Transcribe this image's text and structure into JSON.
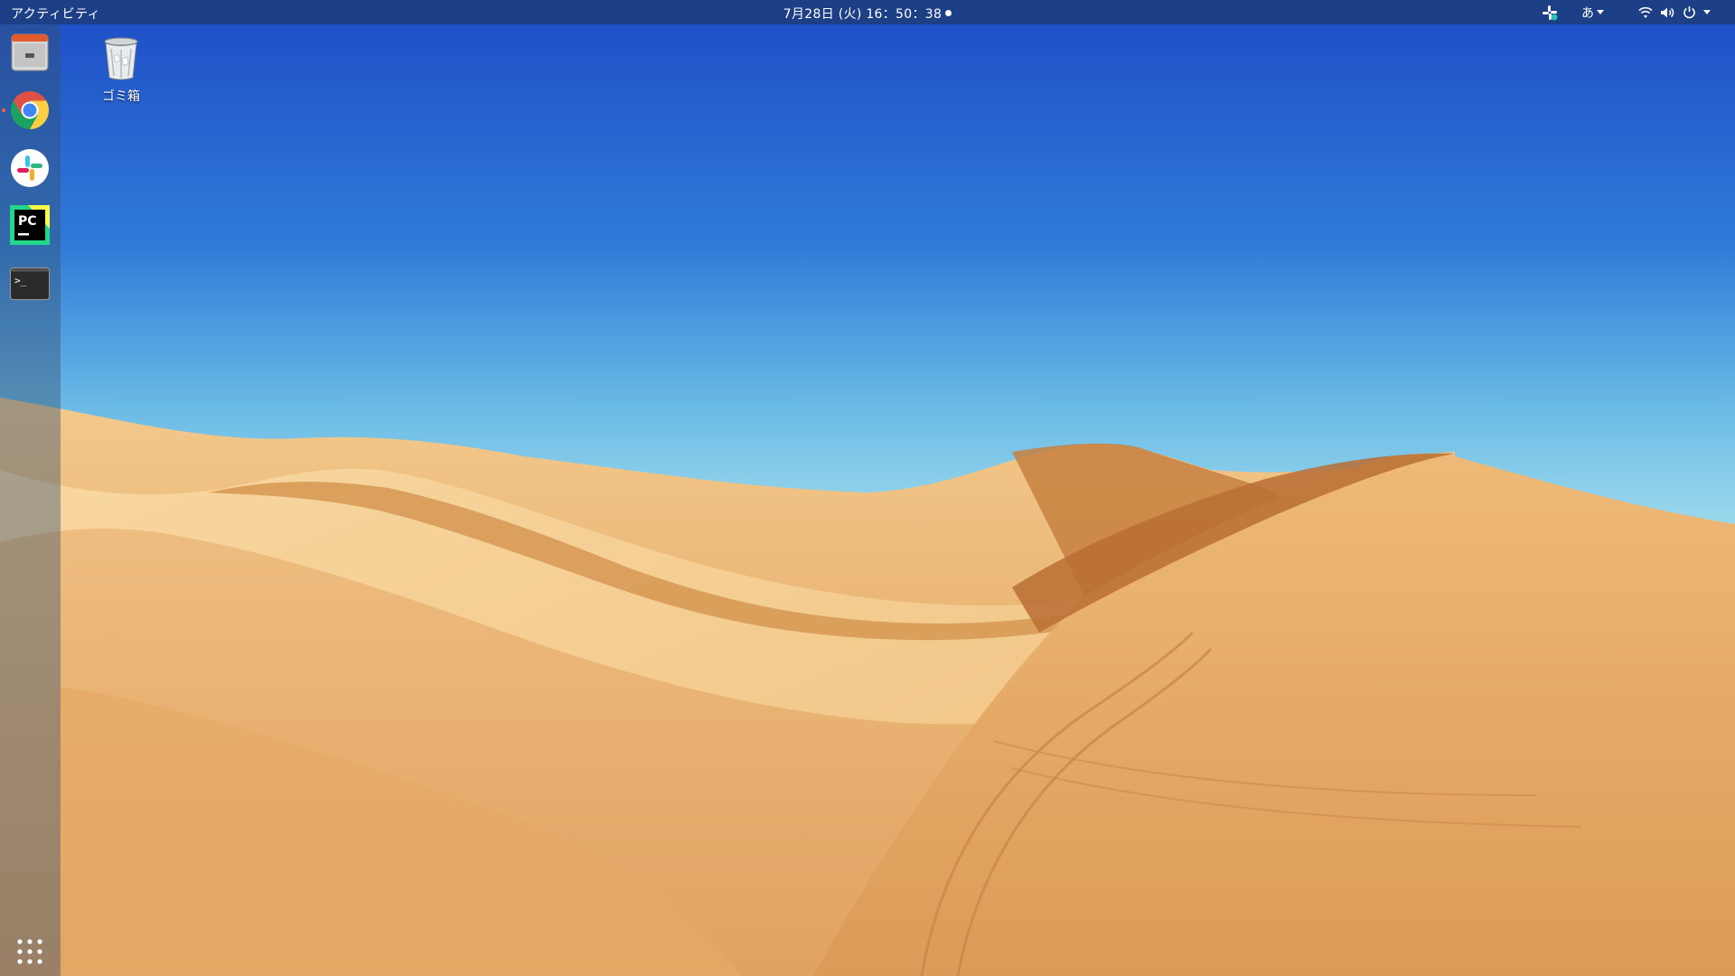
{
  "topbar": {
    "activities_label": "アクティビティ",
    "clock": "7月28日 (火) 16：50：38",
    "tray": {
      "slack_indicator_icon": "slack-icon",
      "input_method_label": "あ",
      "wifi_icon": "wifi-icon",
      "volume_icon": "volume-icon",
      "power_icon": "power-icon"
    }
  },
  "dock": {
    "items": [
      {
        "name": "files",
        "icon": "file-cabinet-icon",
        "running": false
      },
      {
        "name": "chrome",
        "icon": "chrome-icon",
        "running": true
      },
      {
        "name": "slack",
        "icon": "slack-icon",
        "running": false
      },
      {
        "name": "pycharm",
        "icon": "pycharm-icon",
        "running": false,
        "label": "PC"
      },
      {
        "name": "terminal",
        "icon": "terminal-icon",
        "running": false,
        "label": ">_"
      }
    ],
    "show_apps_icon": "app-grid-icon"
  },
  "desktop": {
    "icons": [
      {
        "label": "ゴミ箱",
        "icon": "trash-icon"
      }
    ]
  },
  "colors": {
    "topbar_bg": "#1d3f86",
    "sky_top": "#1f55c8",
    "sky_horizon": "#9ad8ea",
    "sand_light": "#f3cf92",
    "sand_shadow": "#c9833f",
    "running_indicator": "#ff5a3c"
  }
}
